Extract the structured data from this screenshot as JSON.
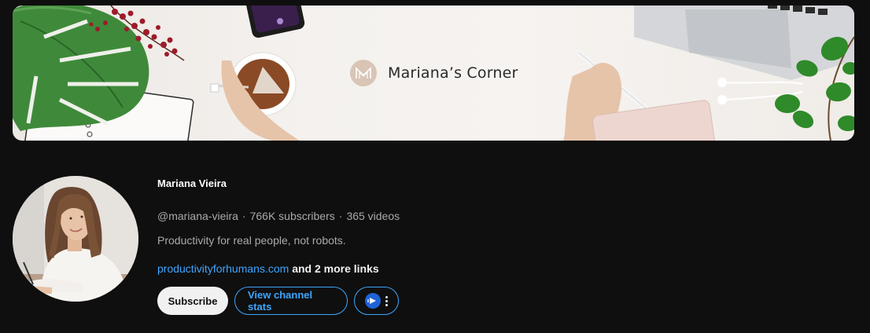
{
  "banner": {
    "brand_name": "Mariana’s Corner"
  },
  "channel": {
    "name": "Mariana Vieira",
    "handle": "@mariana-vieira",
    "subscribers": "766K subscribers",
    "videos": "365 videos",
    "separator": "·",
    "description": "Productivity for real people, not robots.",
    "link": "productivityforhumans.com",
    "more_links": "and 2 more links"
  },
  "actions": {
    "subscribe_label": "Subscribe",
    "stats_label": "View channel stats",
    "extension_icon": "analytics-extension-icon",
    "menu_icon": "more-vert-icon"
  },
  "colors": {
    "background": "#0f0f0f",
    "link": "#3ea6ff",
    "secondary_text": "#aaaaaa"
  }
}
